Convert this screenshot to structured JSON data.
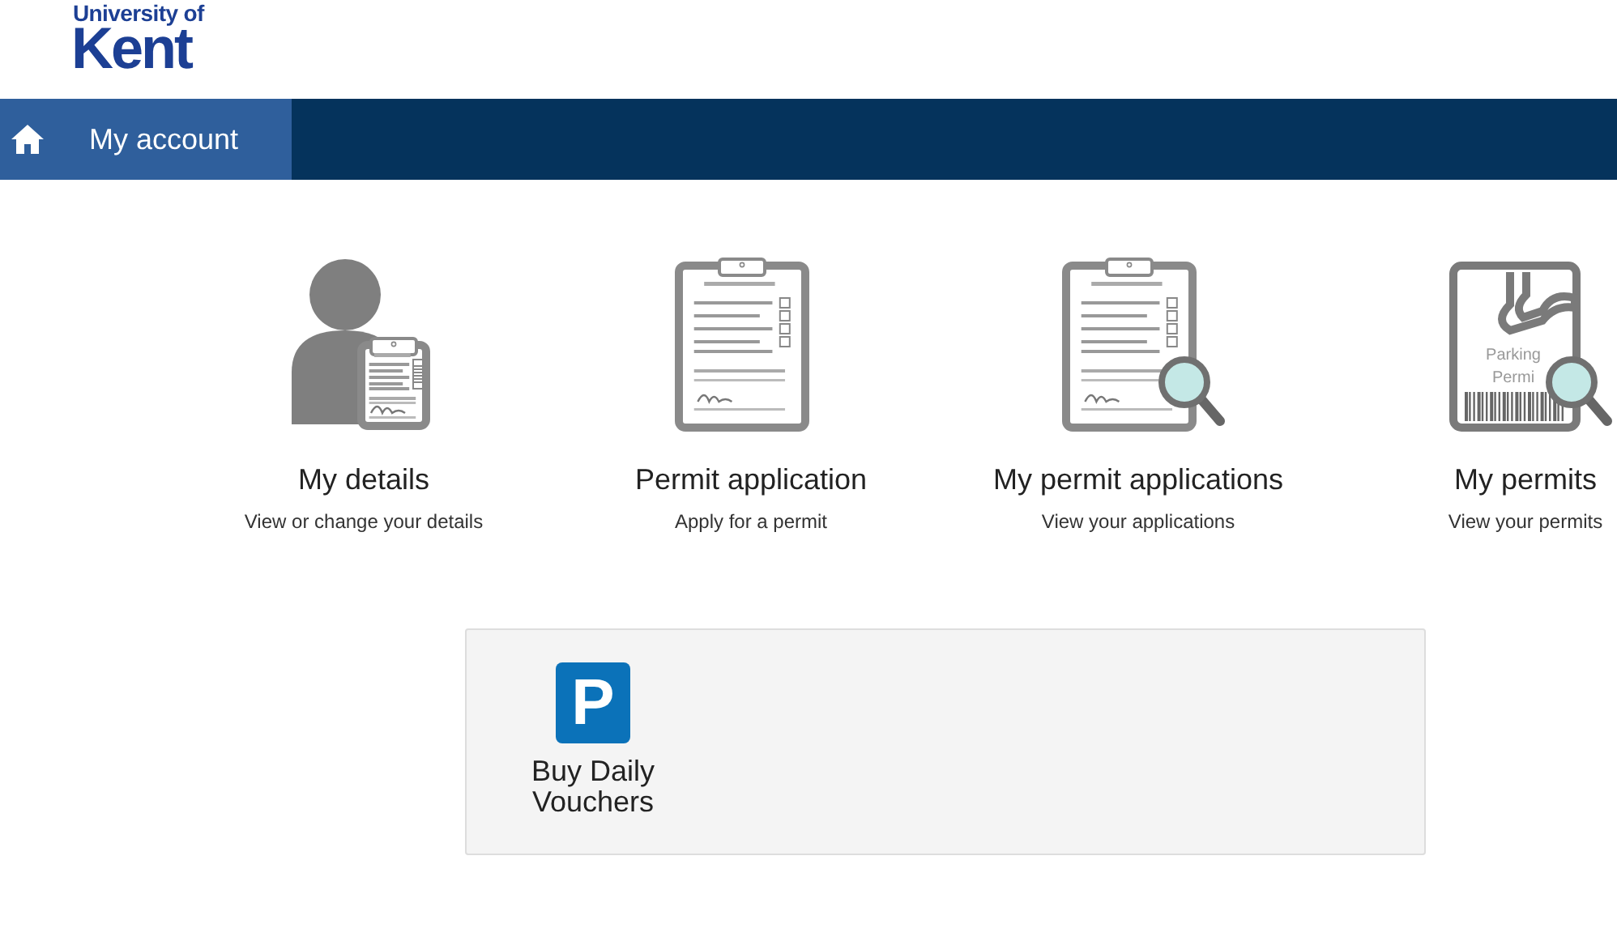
{
  "logo": {
    "line_1": "University of",
    "line_2": "Kent"
  },
  "nav": {
    "tabs": [
      {
        "label": "My account",
        "selected": true
      }
    ]
  },
  "tiles": [
    {
      "kind": "person",
      "title": "My details",
      "subtitle": "View or change your details"
    },
    {
      "kind": "clipboard",
      "title": "Permit application",
      "subtitle": "Apply for a permit"
    },
    {
      "kind": "clipboard-search",
      "title": "My permit applications",
      "subtitle": "View your applications"
    },
    {
      "kind": "permit-search",
      "title": "My permits",
      "subtitle": "View your permits",
      "icon_text": [
        "Parking",
        "Permi"
      ]
    }
  ],
  "panel": {
    "items": [
      {
        "symbol": "P",
        "label": "Buy Daily Vouchers"
      }
    ]
  }
}
